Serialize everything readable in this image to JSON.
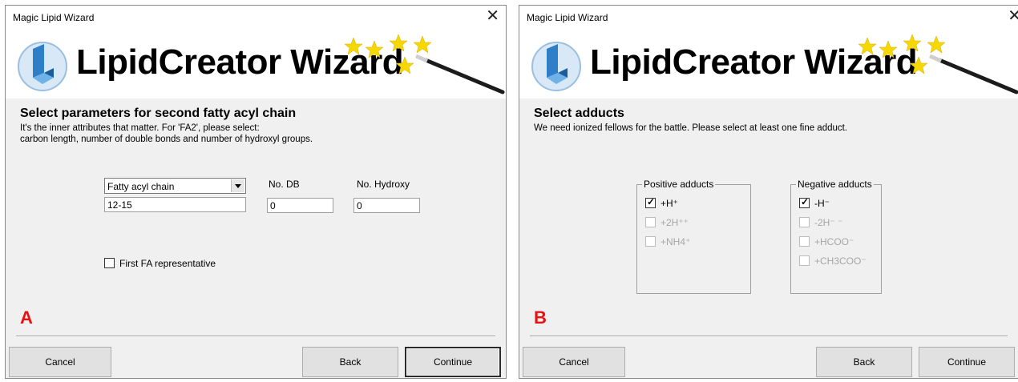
{
  "windows": [
    {
      "title": "Magic Lipid Wizard",
      "banner_title": "LipidCreator Wizard",
      "panel_letter": "A",
      "section": {
        "title": "Select parameters for second fatty acyl chain",
        "desc_line1": "It's the inner attributes that matter. For 'FA2', please select:",
        "desc_line2": "carbon length, number of double bonds and number of hydroxyl groups."
      },
      "fields": {
        "chain_type": "Fatty acyl chain",
        "carbon_length": "12-15",
        "db_label": "No. DB",
        "db_value": "0",
        "hydroxy_label": "No. Hydroxy",
        "hydroxy_value": "0",
        "first_fa_label": "First FA representative",
        "first_fa_checked": false
      },
      "buttons": {
        "cancel": "Cancel",
        "back": "Back",
        "continue": "Continue"
      }
    },
    {
      "title": "Magic Lipid Wizard",
      "banner_title": "LipidCreator Wizard",
      "panel_letter": "B",
      "section": {
        "title": "Select adducts",
        "desc_line1": "We need ionized fellows for the battle. Please select at least one fine adduct."
      },
      "positive_adducts": {
        "legend": "Positive adducts",
        "items": [
          {
            "label": "+H⁺",
            "checked": true,
            "enabled": true
          },
          {
            "label": "+2H⁺⁺",
            "checked": false,
            "enabled": false
          },
          {
            "label": "+NH4⁺",
            "checked": false,
            "enabled": false
          }
        ]
      },
      "negative_adducts": {
        "legend": "Negative adducts",
        "items": [
          {
            "label": "-H⁻",
            "checked": true,
            "enabled": true
          },
          {
            "label": "-2H⁻ ⁻",
            "checked": false,
            "enabled": false
          },
          {
            "label": "+HCOO⁻",
            "checked": false,
            "enabled": false
          },
          {
            "label": "+CH3COO⁻",
            "checked": false,
            "enabled": false
          }
        ]
      },
      "buttons": {
        "cancel": "Cancel",
        "back": "Back",
        "continue": "Continue"
      }
    }
  ],
  "icons": {
    "logo": "lipidcreator-logo-icon",
    "wand": "magic-wand-stars-icon",
    "close": "close-icon"
  },
  "colors": {
    "panel_letter": "#e81010",
    "star": "#f5d800",
    "logo_blue": "#2f7fc8"
  }
}
